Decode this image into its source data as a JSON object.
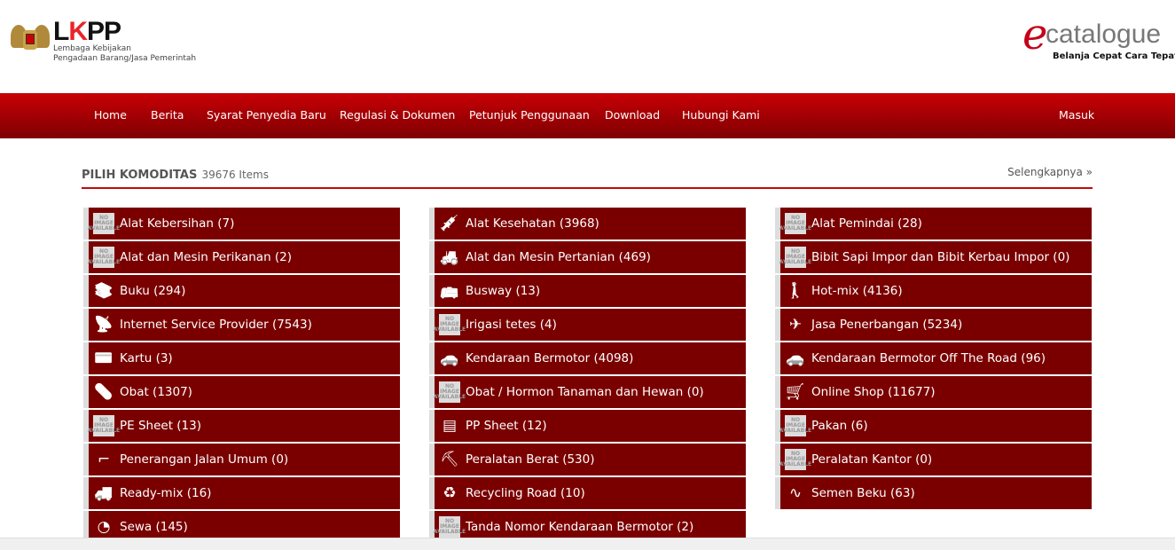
{
  "header": {
    "lkpp": {
      "name": "LKPP",
      "subtitle_1": "Lembaga Kebijakan",
      "subtitle_2": "Pengadaan Barang/Jasa Pemerintah"
    },
    "ecatalogue": {
      "e": "e",
      "name": "catalogue",
      "tagline": "Belanja Cepat Cara Tepat"
    }
  },
  "nav": {
    "items": [
      "Home",
      "Berita",
      "Syarat Penyedia Baru",
      "Regulasi & Dokumen",
      "Petunjuk Penggunaan",
      "Download",
      "Hubungi Kami"
    ],
    "login": "Masuk"
  },
  "section": {
    "title": "PILIH KOMODITAS",
    "count": "39676 Items",
    "more": "Selengkapnya »"
  },
  "no_image_text": [
    "NO",
    "IMAGE",
    "AVAILABLE"
  ],
  "columns": [
    [
      {
        "label": "Alat Kebersihan (7)",
        "icon": "no-image"
      },
      {
        "label": "Alat dan Mesin Perikanan (2)",
        "icon": "no-image"
      },
      {
        "label": "Buku (294)",
        "icon": "books"
      },
      {
        "label": "Internet Service Provider (7543)",
        "icon": "antenna"
      },
      {
        "label": "Kartu (3)",
        "icon": "cards"
      },
      {
        "label": "Obat (1307)",
        "icon": "pills"
      },
      {
        "label": "PE Sheet (13)",
        "icon": "no-image"
      },
      {
        "label": "Penerangan Jalan Umum (0)",
        "icon": "street-lamp"
      },
      {
        "label": "Ready-mix (16)",
        "icon": "mixer-truck"
      },
      {
        "label": "Sewa (145)",
        "icon": "clock"
      }
    ],
    [
      {
        "label": "Alat Kesehatan (3968)",
        "icon": "syringe"
      },
      {
        "label": "Alat dan Mesin Pertanian (469)",
        "icon": "tractor"
      },
      {
        "label": "Busway (13)",
        "icon": "bus"
      },
      {
        "label": "Irigasi tetes (4)",
        "icon": "no-image"
      },
      {
        "label": "Kendaraan Bermotor (4098)",
        "icon": "car"
      },
      {
        "label": "Obat / Hormon Tanaman dan Hewan (0)",
        "icon": "no-image"
      },
      {
        "label": "PP Sheet (12)",
        "icon": "sheet-roll"
      },
      {
        "label": "Peralatan Berat (530)",
        "icon": "excavator"
      },
      {
        "label": "Recycling Road (10)",
        "icon": "recycle"
      },
      {
        "label": "Tanda Nomor Kendaraan Bermotor (2)",
        "icon": "no-image"
      }
    ],
    [
      {
        "label": "Alat Pemindai (28)",
        "icon": "no-image"
      },
      {
        "label": "Bibit Sapi Impor dan Bibit Kerbau Impor (0)",
        "icon": "no-image"
      },
      {
        "label": "Hot-mix (4136)",
        "icon": "worker"
      },
      {
        "label": "Jasa Penerbangan (5234)",
        "icon": "plane-ticket"
      },
      {
        "label": "Kendaraan Bermotor Off The Road (96)",
        "icon": "car"
      },
      {
        "label": "Online Shop (11677)",
        "icon": "cart"
      },
      {
        "label": "Pakan (6)",
        "icon": "no-image"
      },
      {
        "label": "Peralatan Kantor (0)",
        "icon": "no-image"
      },
      {
        "label": "Semen Beku (63)",
        "icon": "sperm"
      }
    ]
  ],
  "colors": {
    "nav_top": "#c80005",
    "nav_bottom": "#7e0002",
    "item_bg": "#7a0000",
    "accent": "#c20a0a"
  }
}
